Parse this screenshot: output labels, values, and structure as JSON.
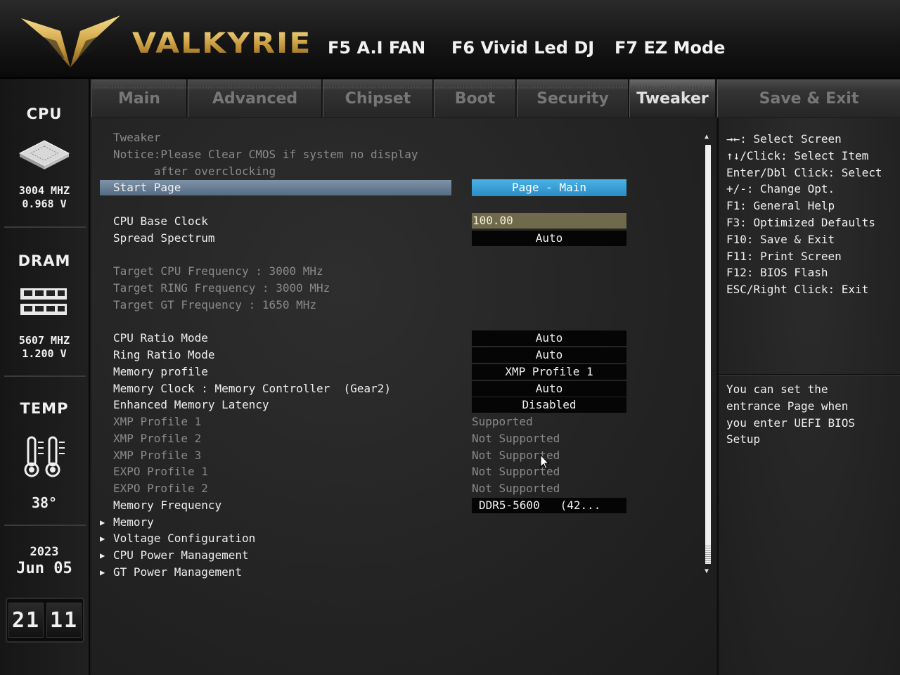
{
  "header": {
    "brand": "VALKYRIE",
    "hotkeys": [
      "F5 A.I FAN",
      "F6 Vivid Led DJ",
      "F7 EZ Mode"
    ]
  },
  "sidebar": {
    "cpu": {
      "title": "CPU",
      "freq": "3004 MHZ",
      "volt": "0.968 V"
    },
    "dram": {
      "title": "DRAM",
      "freq": "5607 MHZ",
      "volt": "1.200 V"
    },
    "temp": {
      "title": "TEMP",
      "value": "38°"
    },
    "date": {
      "year": "2023",
      "monthday": "Jun 05"
    },
    "clock": {
      "hours": "21",
      "minutes": "11"
    }
  },
  "tabs": [
    "Main",
    "Advanced",
    "Chipset",
    "Boot",
    "Security",
    "Tweaker"
  ],
  "active_tab": "Tweaker",
  "save_tab": "Save & Exit",
  "main": {
    "section_title": "Tweaker",
    "notice_line1": "Notice:Please Clear CMOS if system no display",
    "notice_line2": "      after overclocking",
    "start_page": {
      "label": "Start Page",
      "value": "Page - Main"
    },
    "cpu_base_clock": {
      "label": "CPU Base Clock",
      "value": "100.00"
    },
    "spread_spectrum": {
      "label": "Spread Spectrum",
      "value": "Auto"
    },
    "targets": [
      "Target CPU Frequency : 3000 MHz",
      "Target RING Frequency : 3000 MHz",
      "Target GT Frequency : 1650 MHz"
    ],
    "options": [
      {
        "label": "CPU Ratio Mode",
        "value": "Auto"
      },
      {
        "label": "Ring Ratio Mode",
        "value": "Auto"
      },
      {
        "label": "Memory profile",
        "value": "XMP Profile 1"
      },
      {
        "label": "Memory Clock : Memory Controller  (Gear2)",
        "value": "Auto"
      },
      {
        "label": "Enhanced Memory Latency",
        "value": "Disabled"
      }
    ],
    "profiles": [
      {
        "label": "XMP Profile 1",
        "value": "Supported"
      },
      {
        "label": "XMP Profile 2",
        "value": "Not Supported"
      },
      {
        "label": "XMP Profile 3",
        "value": "Not Supported"
      },
      {
        "label": "EXPO Profile 1",
        "value": "Not Supported"
      },
      {
        "label": "EXPO Profile 2",
        "value": "Not Supported"
      }
    ],
    "memory_frequency": {
      "label": "Memory Frequency",
      "value": "DDR5-5600   (42..."
    },
    "submenus": [
      "Memory",
      "Voltage Configuration",
      "CPU Power Management",
      "GT Power Management"
    ]
  },
  "help": {
    "keys": [
      "→←: Select Screen",
      "↑↓/Click: Select Item",
      "Enter/Dbl Click: Select",
      "+/-: Change Opt.",
      "F1: General Help",
      "F3: Optimized Defaults",
      "F10: Save & Exit",
      "F11: Print Screen",
      "F12: BIOS Flash",
      "ESC/Right Click: Exit"
    ],
    "description": [
      "You can set the",
      "entrance Page when",
      "you enter UEFI BIOS",
      "Setup"
    ]
  },
  "colors": {
    "accent_gold": "#d9b25a",
    "selected_blue": "#3aa0d8",
    "input_olive": "#706a4c"
  }
}
